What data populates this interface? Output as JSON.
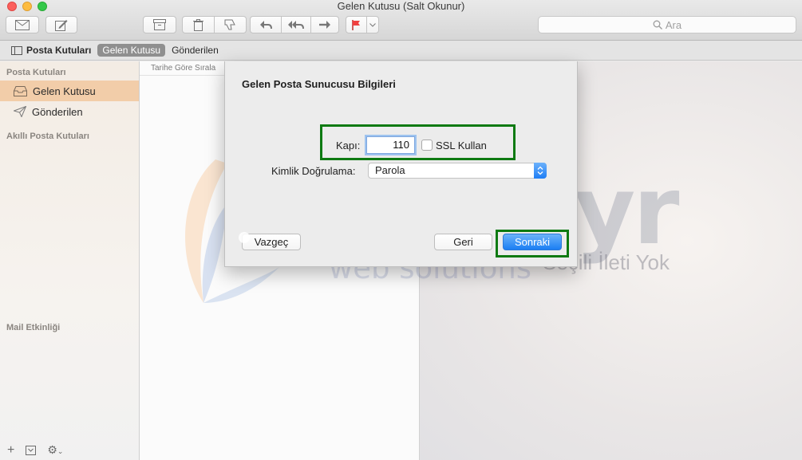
{
  "window": {
    "title": "Gelen Kutusu (Salt Okunur)"
  },
  "toolbar": {
    "search_placeholder": "Ara"
  },
  "favorites": {
    "mailboxes_label": "Posta Kutuları",
    "inbox_label": "Gelen Kutusu",
    "sent_label": "Gönderilen"
  },
  "sidebar": {
    "section_mailboxes": "Posta Kutuları",
    "items": [
      {
        "label": "Gelen Kutusu",
        "selected": true
      },
      {
        "label": "Gönderilen",
        "selected": false
      }
    ],
    "section_smart": "Akıllı Posta Kutuları",
    "section_activity": "Mail Etkinliği"
  },
  "message_list": {
    "sort_label": "Tarihe Göre Sırala"
  },
  "viewer": {
    "empty_label": "Seçili İleti Yok"
  },
  "watermark": {
    "line1": "alastyr",
    "line2": "web solutions"
  },
  "dialog": {
    "title": "Gelen Posta Sunucusu Bilgileri",
    "port_label": "Kapı:",
    "port_value": "110",
    "ssl_label": "SSL Kullan",
    "ssl_checked": false,
    "auth_label": "Kimlik Doğrulama:",
    "auth_value": "Parola",
    "cancel_label": "Vazgeç",
    "back_label": "Geri",
    "next_label": "Sonraki"
  },
  "colors": {
    "highlight": "#0e7a12",
    "selected_sidebar": "#f2cda9",
    "primary_button": "#1b7ef3"
  }
}
